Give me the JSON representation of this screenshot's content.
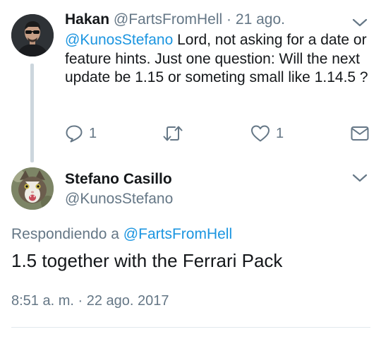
{
  "tweet1": {
    "name": "Hakan",
    "handle": "@FartsFromHell",
    "separator": "·",
    "date": "21 ago.",
    "mention": "@KunosStefano",
    "text": " Lord, not asking for a date or feature hints. Just one question: Will the next update be 1.15 or someting small like 1.14.5 ?",
    "actions": {
      "reply_count": "1",
      "retweet_count": "",
      "like_count": "1"
    },
    "icons": [
      "reply-icon",
      "retweet-icon",
      "like-icon",
      "message-icon",
      "chevron-down-icon"
    ]
  },
  "tweet2": {
    "name": "Stefano Casillo",
    "handle": "@KunosStefano",
    "replying_label": "Respondiendo a ",
    "replying_to": "@FartsFromHell",
    "text": "1.5 together with the Ferrari Pack",
    "timestamp": "8:51 a. m. · 22 ago. 2017"
  },
  "colors": {
    "text": "#14171a",
    "secondary": "#657786",
    "link": "#1b95e0",
    "thread_line": "#ccd6dd"
  }
}
